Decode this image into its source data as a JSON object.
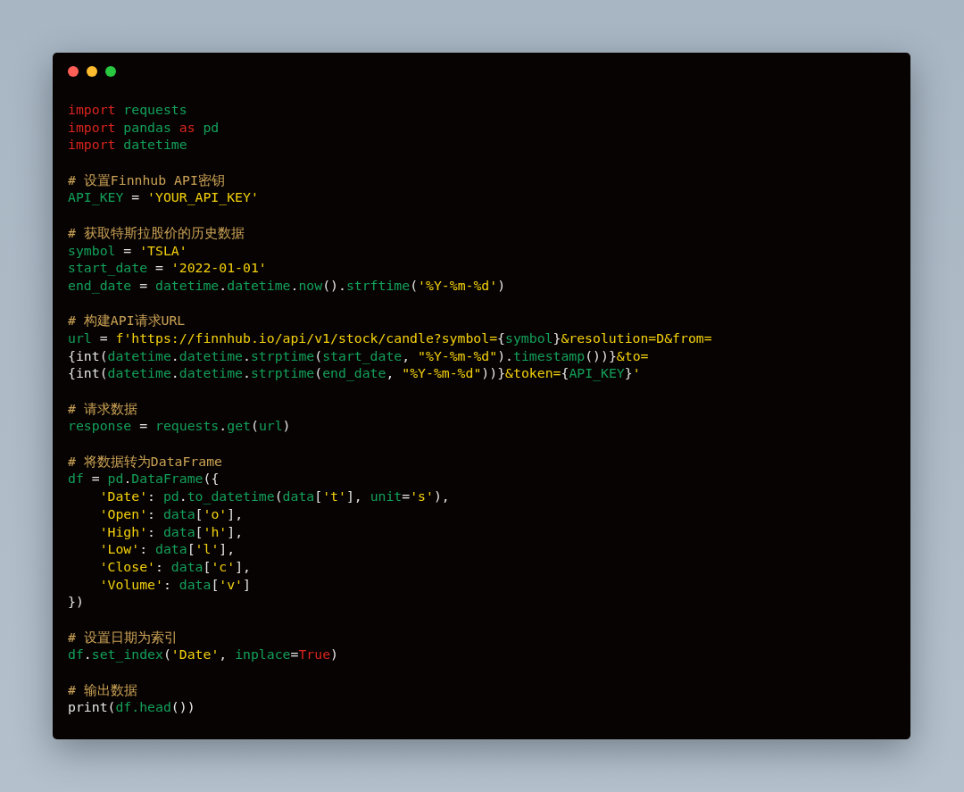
{
  "window": {
    "controls": [
      {
        "kind": "close"
      },
      {
        "kind": "minimize"
      },
      {
        "kind": "zoom"
      }
    ]
  },
  "code_lines": [
    {
      "kind": "code",
      "tokens": [
        {
          "text": "import ",
          "kind": "keyword"
        },
        {
          "text": "requests",
          "kind": "name"
        }
      ]
    },
    {
      "kind": "code",
      "tokens": [
        {
          "text": "import ",
          "kind": "keyword"
        },
        {
          "text": "pandas ",
          "kind": "name"
        },
        {
          "text": "as ",
          "kind": "keyword"
        },
        {
          "text": "pd",
          "kind": "name"
        }
      ]
    },
    {
      "kind": "code",
      "tokens": [
        {
          "text": "import ",
          "kind": "keyword"
        },
        {
          "text": "datetime",
          "kind": "name"
        }
      ]
    },
    {
      "kind": "blank"
    },
    {
      "kind": "code",
      "tokens": [
        {
          "text": "# 设置Finnhub API密钥",
          "kind": "comment"
        }
      ]
    },
    {
      "kind": "code",
      "tokens": [
        {
          "text": "API_KEY",
          "kind": "name"
        },
        {
          "text": " = ",
          "kind": "plain"
        },
        {
          "text": "'YOUR_API_KEY'",
          "kind": "string"
        }
      ]
    },
    {
      "kind": "blank"
    },
    {
      "kind": "code",
      "tokens": [
        {
          "text": "# 获取特斯拉股价的历史数据",
          "kind": "comment"
        }
      ]
    },
    {
      "kind": "code",
      "tokens": [
        {
          "text": "symbol",
          "kind": "name"
        },
        {
          "text": " = ",
          "kind": "plain"
        },
        {
          "text": "'TSLA'",
          "kind": "string"
        }
      ]
    },
    {
      "kind": "code",
      "tokens": [
        {
          "text": "start_date",
          "kind": "name"
        },
        {
          "text": " = ",
          "kind": "plain"
        },
        {
          "text": "'2022-01-01'",
          "kind": "string"
        }
      ]
    },
    {
      "kind": "code",
      "tokens": [
        {
          "text": "end_date",
          "kind": "name"
        },
        {
          "text": " = ",
          "kind": "plain"
        },
        {
          "text": "datetime",
          "kind": "name"
        },
        {
          "text": ".",
          "kind": "plain"
        },
        {
          "text": "datetime",
          "kind": "name"
        },
        {
          "text": ".",
          "kind": "plain"
        },
        {
          "text": "now",
          "kind": "name"
        },
        {
          "text": "().",
          "kind": "plain"
        },
        {
          "text": "strftime",
          "kind": "name"
        },
        {
          "text": "(",
          "kind": "plain"
        },
        {
          "text": "'%Y-%m-%d'",
          "kind": "string"
        },
        {
          "text": ")",
          "kind": "plain"
        }
      ]
    },
    {
      "kind": "blank"
    },
    {
      "kind": "code",
      "tokens": [
        {
          "text": "# 构建API请求URL",
          "kind": "comment"
        }
      ]
    },
    {
      "kind": "code",
      "tokens": [
        {
          "text": "url",
          "kind": "name"
        },
        {
          "text": " = ",
          "kind": "plain"
        },
        {
          "text": "f'https://finnhub.io/api/v1/stock/candle?symbol=",
          "kind": "string"
        },
        {
          "text": "{",
          "kind": "plain"
        },
        {
          "text": "symbol",
          "kind": "name"
        },
        {
          "text": "}",
          "kind": "plain"
        },
        {
          "text": "&resolution=D&from=",
          "kind": "string"
        }
      ]
    },
    {
      "kind": "code",
      "tokens": [
        {
          "text": "{int(",
          "kind": "plain"
        },
        {
          "text": "datetime",
          "kind": "name"
        },
        {
          "text": ".",
          "kind": "plain"
        },
        {
          "text": "datetime",
          "kind": "name"
        },
        {
          "text": ".",
          "kind": "plain"
        },
        {
          "text": "strptime",
          "kind": "name"
        },
        {
          "text": "(",
          "kind": "plain"
        },
        {
          "text": "start_date",
          "kind": "name"
        },
        {
          "text": ", ",
          "kind": "plain"
        },
        {
          "text": "\"%Y-%m-%d\"",
          "kind": "string"
        },
        {
          "text": ").",
          "kind": "plain"
        },
        {
          "text": "timestamp",
          "kind": "name"
        },
        {
          "text": "())}",
          "kind": "plain"
        },
        {
          "text": "&to=",
          "kind": "string"
        }
      ]
    },
    {
      "kind": "code",
      "tokens": [
        {
          "text": "{int(",
          "kind": "plain"
        },
        {
          "text": "datetime",
          "kind": "name"
        },
        {
          "text": ".",
          "kind": "plain"
        },
        {
          "text": "datetime",
          "kind": "name"
        },
        {
          "text": ".",
          "kind": "plain"
        },
        {
          "text": "strptime",
          "kind": "name"
        },
        {
          "text": "(",
          "kind": "plain"
        },
        {
          "text": "end_date",
          "kind": "name"
        },
        {
          "text": ", ",
          "kind": "plain"
        },
        {
          "text": "\"%Y-%m-%d\"",
          "kind": "string"
        },
        {
          "text": "))}",
          "kind": "plain"
        },
        {
          "text": "&token=",
          "kind": "string"
        },
        {
          "text": "{",
          "kind": "plain"
        },
        {
          "text": "API_KEY",
          "kind": "name"
        },
        {
          "text": "}",
          "kind": "plain"
        },
        {
          "text": "'",
          "kind": "string"
        }
      ]
    },
    {
      "kind": "blank"
    },
    {
      "kind": "code",
      "tokens": [
        {
          "text": "# 请求数据",
          "kind": "comment"
        }
      ]
    },
    {
      "kind": "code",
      "tokens": [
        {
          "text": "response",
          "kind": "name"
        },
        {
          "text": " = ",
          "kind": "plain"
        },
        {
          "text": "requests",
          "kind": "name"
        },
        {
          "text": ".",
          "kind": "plain"
        },
        {
          "text": "get",
          "kind": "name"
        },
        {
          "text": "(",
          "kind": "plain"
        },
        {
          "text": "url",
          "kind": "name"
        },
        {
          "text": ")",
          "kind": "plain"
        }
      ]
    },
    {
      "kind": "blank"
    },
    {
      "kind": "code",
      "tokens": [
        {
          "text": "# 将数据转为DataFrame",
          "kind": "comment"
        }
      ]
    },
    {
      "kind": "code",
      "tokens": [
        {
          "text": "df",
          "kind": "name"
        },
        {
          "text": " = ",
          "kind": "plain"
        },
        {
          "text": "pd",
          "kind": "name"
        },
        {
          "text": ".",
          "kind": "plain"
        },
        {
          "text": "DataFrame",
          "kind": "name"
        },
        {
          "text": "({",
          "kind": "plain"
        }
      ]
    },
    {
      "kind": "code",
      "tokens": [
        {
          "text": "    'Date'",
          "kind": "string"
        },
        {
          "text": ": ",
          "kind": "plain"
        },
        {
          "text": "pd",
          "kind": "name"
        },
        {
          "text": ".",
          "kind": "plain"
        },
        {
          "text": "to_datetime",
          "kind": "name"
        },
        {
          "text": "(",
          "kind": "plain"
        },
        {
          "text": "data",
          "kind": "name"
        },
        {
          "text": "[",
          "kind": "plain"
        },
        {
          "text": "'t'",
          "kind": "string"
        },
        {
          "text": "], ",
          "kind": "plain"
        },
        {
          "text": "unit",
          "kind": "name"
        },
        {
          "text": "=",
          "kind": "plain"
        },
        {
          "text": "'s'",
          "kind": "string"
        },
        {
          "text": "),",
          "kind": "plain"
        }
      ]
    },
    {
      "kind": "code",
      "tokens": [
        {
          "text": "    'Open'",
          "kind": "string"
        },
        {
          "text": ": ",
          "kind": "plain"
        },
        {
          "text": "data",
          "kind": "name"
        },
        {
          "text": "[",
          "kind": "plain"
        },
        {
          "text": "'o'",
          "kind": "string"
        },
        {
          "text": "],",
          "kind": "plain"
        }
      ]
    },
    {
      "kind": "code",
      "tokens": [
        {
          "text": "    'High'",
          "kind": "string"
        },
        {
          "text": ": ",
          "kind": "plain"
        },
        {
          "text": "data",
          "kind": "name"
        },
        {
          "text": "[",
          "kind": "plain"
        },
        {
          "text": "'h'",
          "kind": "string"
        },
        {
          "text": "],",
          "kind": "plain"
        }
      ]
    },
    {
      "kind": "code",
      "tokens": [
        {
          "text": "    'Low'",
          "kind": "string"
        },
        {
          "text": ": ",
          "kind": "plain"
        },
        {
          "text": "data",
          "kind": "name"
        },
        {
          "text": "[",
          "kind": "plain"
        },
        {
          "text": "'l'",
          "kind": "string"
        },
        {
          "text": "],",
          "kind": "plain"
        }
      ]
    },
    {
      "kind": "code",
      "tokens": [
        {
          "text": "    'Close'",
          "kind": "string"
        },
        {
          "text": ": ",
          "kind": "plain"
        },
        {
          "text": "data",
          "kind": "name"
        },
        {
          "text": "[",
          "kind": "plain"
        },
        {
          "text": "'c'",
          "kind": "string"
        },
        {
          "text": "],",
          "kind": "plain"
        }
      ]
    },
    {
      "kind": "code",
      "tokens": [
        {
          "text": "    'Volume'",
          "kind": "string"
        },
        {
          "text": ": ",
          "kind": "plain"
        },
        {
          "text": "data",
          "kind": "name"
        },
        {
          "text": "[",
          "kind": "plain"
        },
        {
          "text": "'v'",
          "kind": "string"
        },
        {
          "text": "]",
          "kind": "plain"
        }
      ]
    },
    {
      "kind": "code",
      "tokens": [
        {
          "text": "})",
          "kind": "plain"
        }
      ]
    },
    {
      "kind": "blank"
    },
    {
      "kind": "code",
      "tokens": [
        {
          "text": "# 设置日期为索引",
          "kind": "comment"
        }
      ]
    },
    {
      "kind": "code",
      "tokens": [
        {
          "text": "df",
          "kind": "name"
        },
        {
          "text": ".",
          "kind": "plain"
        },
        {
          "text": "set_index",
          "kind": "name"
        },
        {
          "text": "(",
          "kind": "plain"
        },
        {
          "text": "'Date'",
          "kind": "string"
        },
        {
          "text": ", ",
          "kind": "plain"
        },
        {
          "text": "inplace",
          "kind": "name"
        },
        {
          "text": "=",
          "kind": "plain"
        },
        {
          "text": "True",
          "kind": "keyword"
        },
        {
          "text": ")",
          "kind": "plain"
        }
      ]
    },
    {
      "kind": "blank"
    },
    {
      "kind": "code",
      "tokens": [
        {
          "text": "# 输出数据",
          "kind": "comment"
        }
      ]
    },
    {
      "kind": "code",
      "tokens": [
        {
          "text": "print(",
          "kind": "plain"
        },
        {
          "text": "df.head",
          "kind": "name"
        },
        {
          "text": "())",
          "kind": "plain"
        }
      ]
    }
  ]
}
